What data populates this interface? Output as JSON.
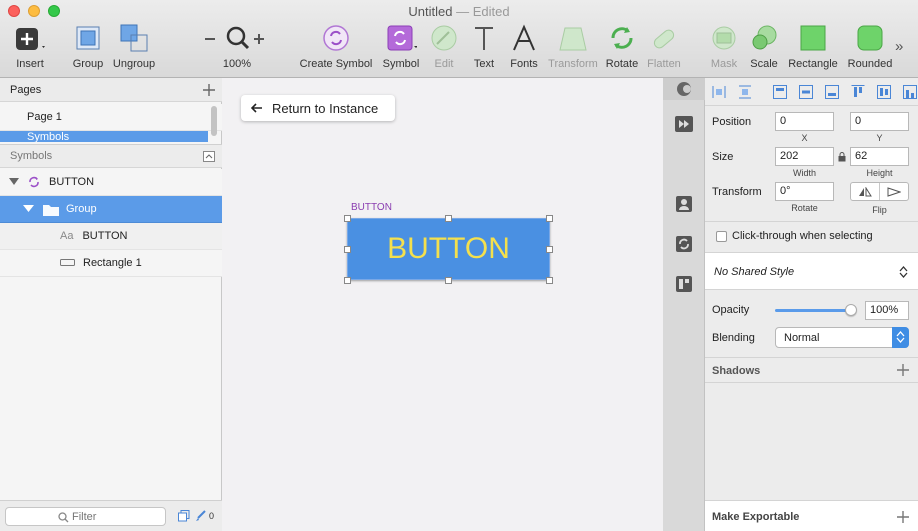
{
  "window": {
    "title": "Untitled",
    "status": "— Edited"
  },
  "toolbar": {
    "insert": "Insert",
    "group": "Group",
    "ungroup": "Ungroup",
    "zoom": "100%",
    "create_symbol": "Create Symbol",
    "symbol": "Symbol",
    "edit": "Edit",
    "text": "Text",
    "fonts": "Fonts",
    "transform": "Transform",
    "rotate": "Rotate",
    "flatten": "Flatten",
    "mask": "Mask",
    "scale": "Scale",
    "rectangle": "Rectangle",
    "rounded": "Rounded",
    "more": "»"
  },
  "pages": {
    "header": "Pages",
    "items": [
      "Page 1",
      "Symbols"
    ]
  },
  "layers": {
    "header": "Symbols",
    "items": [
      {
        "label": "BUTTON",
        "type": "symbol"
      },
      {
        "label": "Group",
        "type": "group"
      },
      {
        "label": "BUTTON",
        "type": "text",
        "badge": "Aa"
      },
      {
        "label": "Rectangle 1",
        "type": "rectangle"
      }
    ]
  },
  "filter": {
    "placeholder": "Filter",
    "count": "0"
  },
  "canvas": {
    "return_label": "Return to Instance",
    "artboard_label": "BUTTON",
    "button_text": "BUTTON"
  },
  "inspector": {
    "position": {
      "label": "Position",
      "x": "0",
      "y": "0",
      "x_label": "X",
      "y_label": "Y"
    },
    "size": {
      "label": "Size",
      "width": "202",
      "height": "62",
      "width_label": "Width",
      "height_label": "Height"
    },
    "transform": {
      "label": "Transform",
      "rotate": "0°",
      "rotate_label": "Rotate",
      "flip_label": "Flip"
    },
    "click_through": "Click-through when selecting",
    "shared_style": "No Shared Style",
    "opacity": {
      "label": "Opacity",
      "value": "100%"
    },
    "blending": {
      "label": "Blending",
      "value": "Normal"
    },
    "shadows": "Shadows",
    "exportable": "Make Exportable"
  },
  "colors": {
    "accent": "#5a9bea",
    "button_fill": "#4a90e2",
    "button_text": "#f4e04d",
    "artboard_label": "#8a3db0",
    "selection": "#5b9be8"
  }
}
